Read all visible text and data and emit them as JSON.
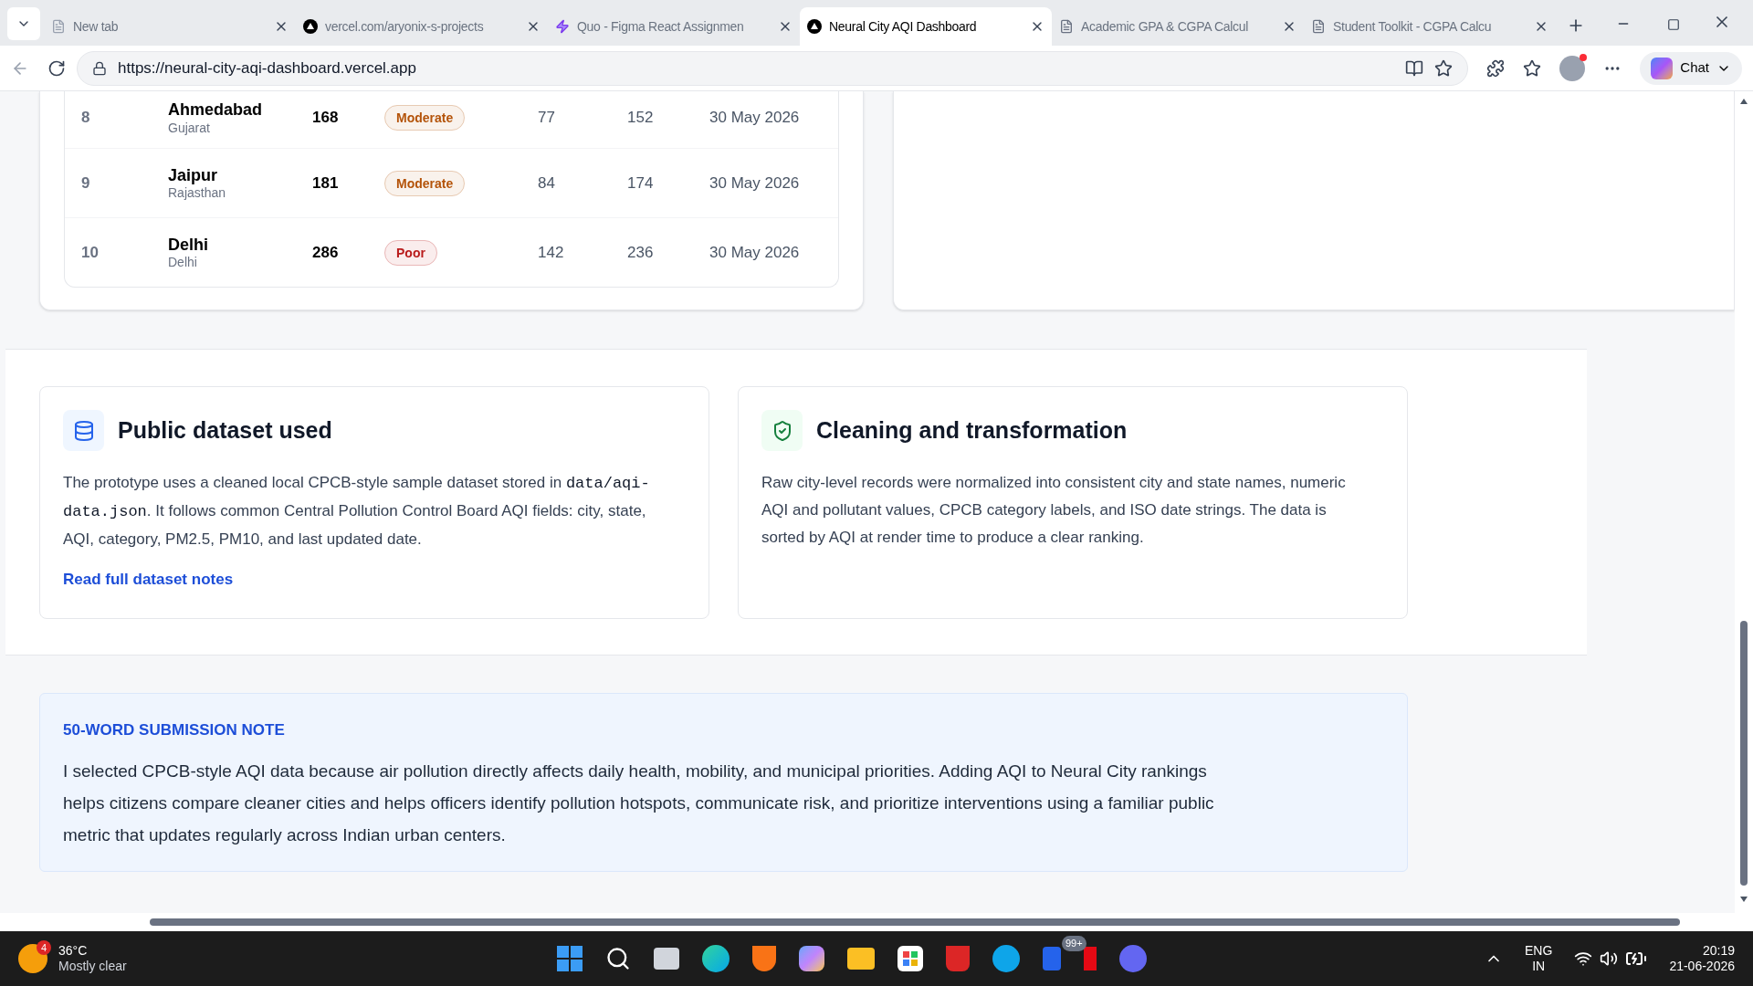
{
  "browser": {
    "tabs": [
      {
        "title": "New tab",
        "kind": "newtab",
        "selected": false
      },
      {
        "title": "vercel.com/aryonix-s-projects",
        "kind": "vercel",
        "selected": false
      },
      {
        "title": "Quo - Figma React Assignmen",
        "kind": "figma",
        "selected": false
      },
      {
        "title": "Neural City AQI Dashboard",
        "kind": "vercel",
        "selected": true
      },
      {
        "title": "Academic GPA & CGPA Calcul",
        "kind": "doc",
        "selected": false
      },
      {
        "title": "Student Toolkit - CGPA Calcu",
        "kind": "doc",
        "selected": false
      }
    ],
    "url": "https://neural-city-aqi-dashboard.vercel.app",
    "chat_label": "Chat"
  },
  "ranking_table": {
    "rows": [
      {
        "rank": "8",
        "city": "Ahmedabad",
        "state": "Gujarat",
        "aqi": "168",
        "category": "Moderate",
        "color": "#b45309",
        "pm25": "77",
        "pm10": "152",
        "updated": "30 May 2026"
      },
      {
        "rank": "9",
        "city": "Jaipur",
        "state": "Rajasthan",
        "aqi": "181",
        "category": "Moderate",
        "color": "#b45309",
        "pm25": "84",
        "pm10": "174",
        "updated": "30 May 2026"
      },
      {
        "rank": "10",
        "city": "Delhi",
        "state": "Delhi",
        "aqi": "286",
        "category": "Poor",
        "color": "#b91c1c",
        "pm25": "142",
        "pm10": "236",
        "updated": "30 May 2026"
      }
    ]
  },
  "info_cards": [
    {
      "kind": "dataset",
      "title": "Public dataset used",
      "body_before": "The prototype uses a cleaned local CPCB-style sample dataset stored in ",
      "code": "data/aqi-data.json",
      "body_after": ". It follows common Central Pollution Control Board AQI fields: city, state, AQI, category, PM2.5, PM10, and last updated date.",
      "link": "Read full dataset notes"
    },
    {
      "kind": "cleaning",
      "title": "Cleaning and transformation",
      "body_before": "Raw city-level records were normalized into consistent city and state names, numeric AQI and pollutant values, CPCB category labels, and ISO date strings. The data is sorted by AQI at render time to produce a clear ranking."
    }
  ],
  "submission_note": {
    "heading": "50-WORD SUBMISSION NOTE",
    "text": "I selected CPCB-style AQI data because air pollution directly affects daily health, mobility, and municipal priorities. Adding AQI to Neural City rankings helps citizens compare cleaner cities and helps officers identify pollution hotspots, communicate risk, and prioritize interventions using a familiar public metric that updates regularly across Indian urban centers."
  },
  "taskbar": {
    "weather_badge": "4",
    "temperature": "36°C",
    "weather": "Mostly clear",
    "store_badge": "99+",
    "language": "ENG",
    "region": "IN",
    "time": "20:19",
    "date": "21-06-2026"
  }
}
